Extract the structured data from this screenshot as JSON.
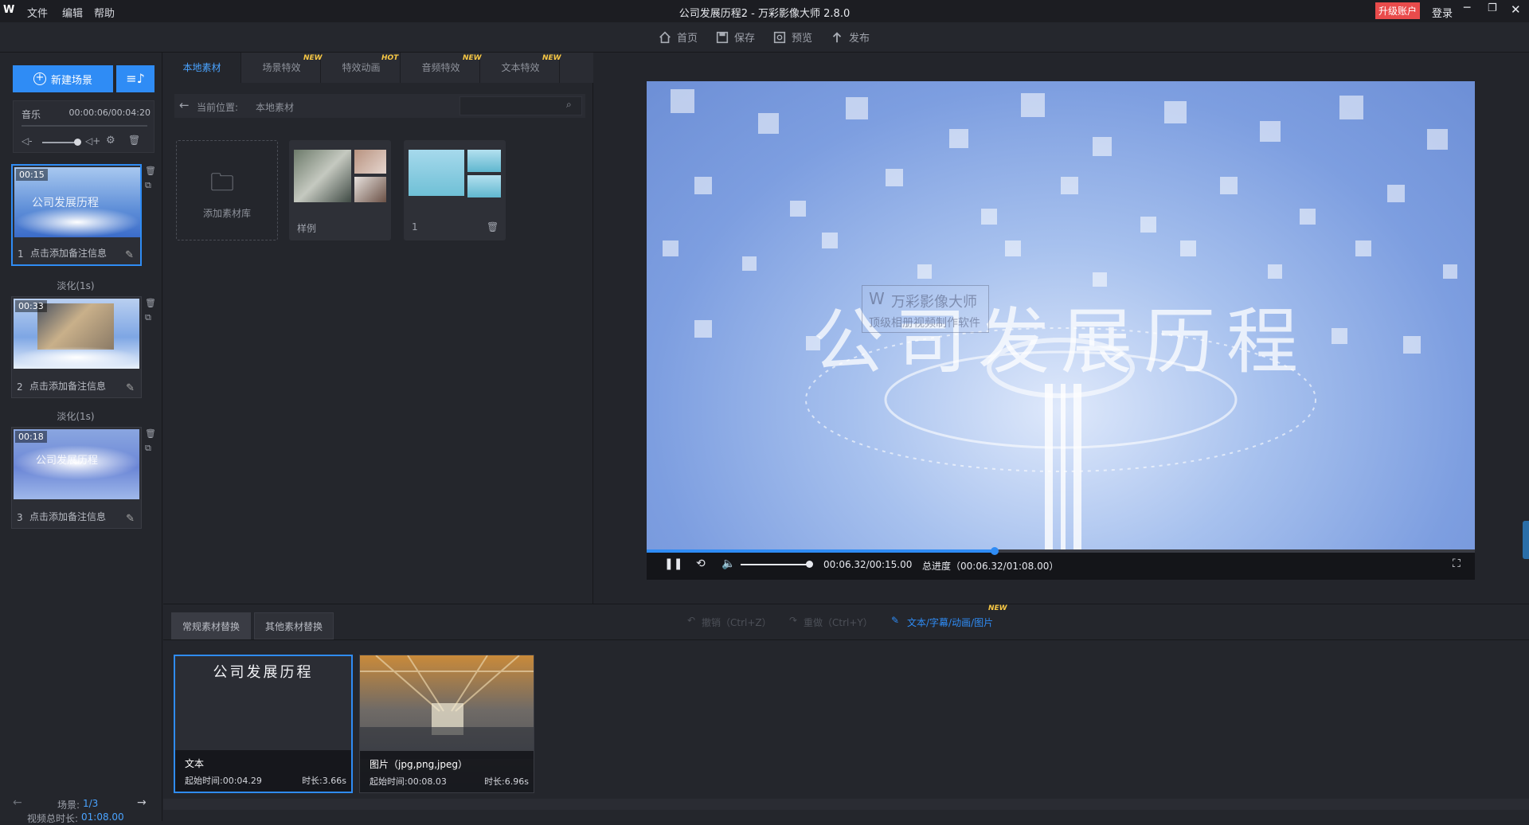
{
  "titlebar": {
    "logo": "W",
    "menu": [
      "文件",
      "编辑",
      "帮助"
    ],
    "title": "公司发展历程2 - 万彩影像大师 2.8.0",
    "upgrade_label": "升级账户",
    "login_label": "登录"
  },
  "toolbar": {
    "home": "首页",
    "save": "保存",
    "preview": "预览",
    "publish": "发布"
  },
  "left": {
    "new_scene_label": "新建场景",
    "music_label": "音乐",
    "music_time": "00:00:06/00:04:20",
    "scenes": [
      {
        "index": "1",
        "time": "00:15",
        "caption": "点击添加备注信息",
        "text": "公司发展历程"
      },
      {
        "index": "2",
        "time": "00:33",
        "caption": "点击添加备注信息",
        "text": ""
      },
      {
        "index": "3",
        "time": "00:18",
        "caption": "点击添加备注信息",
        "text": "公司发展历程"
      }
    ],
    "transitions": [
      "淡化(1s)",
      "淡化(1s)"
    ],
    "scene_counter_label": "场景:",
    "scene_counter_value": "1/3",
    "total_duration_label": "视频总时长:",
    "total_duration_value": "01:08.00"
  },
  "middle": {
    "tabs": [
      {
        "label": "本地素材",
        "badge": ""
      },
      {
        "label": "场景特效",
        "badge": "NEW"
      },
      {
        "label": "特效动画",
        "badge": "HOT"
      },
      {
        "label": "音频特效",
        "badge": "NEW"
      },
      {
        "label": "文本特效",
        "badge": "NEW"
      }
    ],
    "location_label": "当前位置:",
    "location_value": "本地素材",
    "search_placeholder": "",
    "add_library_label": "添加素材库",
    "folders": [
      {
        "label": "样例"
      },
      {
        "label": "1"
      }
    ]
  },
  "preview": {
    "watermark_title": "万彩影像大师",
    "watermark_sub": "顶级相册视频制作软件",
    "main_text": "公司发展历程",
    "time": "00:06.32/00:15.00",
    "total_progress": "总进度（00:06.32/01:08.00）",
    "progress": 0.42,
    "volume": 0.95
  },
  "bottom": {
    "tabs": [
      "常规素材替换",
      "其他素材替换"
    ],
    "undo_label": "撤销（Ctrl+Z）",
    "redo_label": "重做（Ctrl+Y）",
    "edit_label": "文本/字幕/动画/图片",
    "edit_badge": "NEW",
    "cards": [
      {
        "title": "公司发展历程",
        "kind": "文本",
        "start": "起始时间:00:04.29",
        "duration": "时长:3.66s"
      },
      {
        "title": "",
        "kind": "图片（jpg,png,jpeg）",
        "start": "起始时间:00:08.03",
        "duration": "时长:6.96s"
      }
    ]
  },
  "colors": {
    "accent": "#2f8cf5",
    "upgrade": "#e94b4b",
    "badge": "#f6c744"
  }
}
